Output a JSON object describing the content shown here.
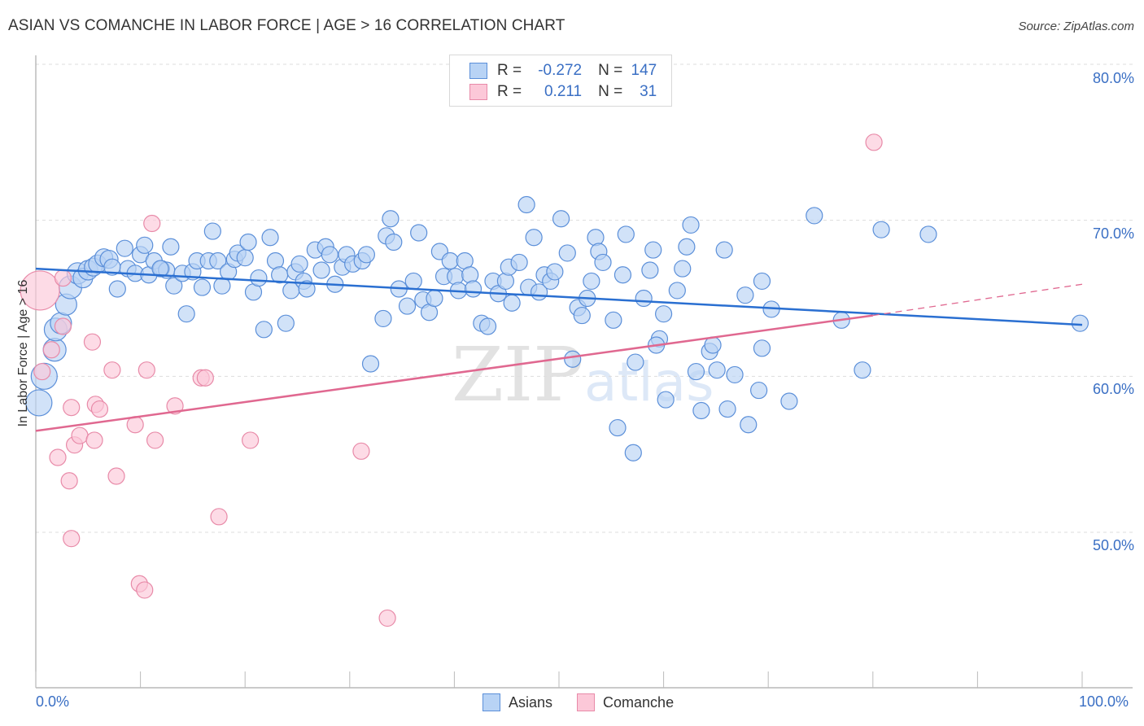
{
  "title": "ASIAN VS COMANCHE IN LABOR FORCE | AGE > 16 CORRELATION CHART",
  "source": "Source: ZipAtlas.com",
  "legend_box": {
    "rows": [
      {
        "r_label": "R =",
        "r_value": "-0.272",
        "n_label": "N =",
        "n_value": "147"
      },
      {
        "r_label": "R =",
        "r_value": "0.211",
        "n_label": "N =",
        "n_value": "31"
      }
    ]
  },
  "bottom_legend": {
    "items": [
      {
        "label": "Asians"
      },
      {
        "label": "Comanche"
      }
    ]
  },
  "colors": {
    "asians_fill": "#b8d3f5",
    "asians_stroke": "#5b8fd9",
    "asians_line": "#2a6fd1",
    "comanche_fill": "#fcc8d8",
    "comanche_stroke": "#e88aa8",
    "comanche_line": "#e06890",
    "tick_text": "#3a6fc4",
    "grid": "#dddddd"
  },
  "chart_data": {
    "type": "scatter",
    "title": "ASIAN VS COMANCHE IN LABOR FORCE | AGE > 16 CORRELATION CHART",
    "xlabel": "",
    "ylabel": "In Labor Force | Age > 16",
    "xlim": [
      0,
      100
    ],
    "ylim": [
      40,
      82
    ],
    "x_tick_labels": [
      {
        "value": 0,
        "label": "0.0%"
      },
      {
        "value": 100,
        "label": "100.0%"
      }
    ],
    "x_minor_ticks": [
      0,
      10,
      20,
      30,
      40,
      50,
      60,
      70,
      80,
      90,
      100
    ],
    "y_ticks": [
      {
        "value": 80,
        "label": "80.0%"
      },
      {
        "value": 70,
        "label": "70.0%"
      },
      {
        "value": 60,
        "label": "60.0%"
      },
      {
        "value": 50,
        "label": "50.0%"
      }
    ],
    "grid": true,
    "legend_placement": "top-center",
    "watermark": "ZIPatlas",
    "series": [
      {
        "name": "Asians",
        "r": -0.272,
        "n": 147,
        "trend": {
          "x": [
            0,
            100
          ],
          "y": [
            66.9,
            63.3
          ],
          "dashed_extension": false
        },
        "points": [
          [
            0.3,
            58.3,
            1.6
          ],
          [
            0.8,
            60.0,
            1.6
          ],
          [
            1.8,
            61.7,
            1.4
          ],
          [
            1.9,
            63.0,
            1.4
          ],
          [
            2.4,
            63.4,
            1.3
          ],
          [
            2.9,
            64.6,
            1.3
          ],
          [
            3.3,
            65.7,
            1.4
          ],
          [
            4.0,
            66.6,
            1.3
          ],
          [
            4.5,
            66.3,
            1.2
          ],
          [
            5.0,
            66.8,
            1.2
          ],
          [
            5.5,
            67.0,
            1.1
          ],
          [
            5.9,
            67.2,
            1.1
          ],
          [
            6.5,
            67.6,
            1.1
          ],
          [
            7.0,
            67.5,
            1.1
          ],
          [
            7.8,
            65.6,
            1.0
          ],
          [
            8.5,
            68.2,
            1.0
          ],
          [
            8.8,
            66.9,
            1.0
          ],
          [
            9.5,
            66.6,
            1.0
          ],
          [
            10.0,
            67.8,
            1.0
          ],
          [
            10.4,
            68.4,
            1.0
          ],
          [
            10.8,
            66.5,
            1.0
          ],
          [
            11.3,
            67.4,
            1.0
          ],
          [
            12.0,
            66.9,
            1.0
          ],
          [
            12.5,
            66.8,
            1.0
          ],
          [
            12.9,
            68.3,
            1.0
          ],
          [
            13.2,
            65.8,
            1.0
          ],
          [
            14.0,
            66.6,
            1.0
          ],
          [
            14.4,
            64.0,
            1.0
          ],
          [
            15.0,
            66.7,
            1.0
          ],
          [
            15.4,
            67.4,
            1.0
          ],
          [
            15.9,
            65.7,
            1.0
          ],
          [
            16.5,
            67.4,
            1.0
          ],
          [
            16.9,
            69.3,
            1.0
          ],
          [
            17.4,
            67.4,
            1.0
          ],
          [
            17.8,
            65.8,
            1.0
          ],
          [
            18.4,
            66.7,
            1.0
          ],
          [
            19.0,
            67.5,
            1.0
          ],
          [
            19.3,
            67.9,
            1.0
          ],
          [
            20.0,
            67.6,
            1.0
          ],
          [
            20.3,
            68.6,
            1.0
          ],
          [
            20.8,
            65.4,
            1.0
          ],
          [
            21.3,
            66.3,
            1.0
          ],
          [
            21.8,
            63.0,
            1.0
          ],
          [
            22.4,
            68.9,
            1.0
          ],
          [
            22.9,
            67.4,
            1.0
          ],
          [
            23.3,
            66.5,
            1.0
          ],
          [
            23.9,
            63.4,
            1.0
          ],
          [
            24.4,
            65.5,
            1.0
          ],
          [
            24.8,
            66.7,
            1.0
          ],
          [
            25.2,
            67.2,
            1.0
          ],
          [
            25.6,
            66.1,
            1.0
          ],
          [
            25.9,
            65.6,
            1.0
          ],
          [
            26.7,
            68.1,
            1.0
          ],
          [
            27.3,
            66.8,
            1.0
          ],
          [
            27.7,
            68.3,
            1.0
          ],
          [
            28.1,
            67.8,
            1.0
          ],
          [
            28.6,
            65.9,
            1.0
          ],
          [
            29.3,
            67.0,
            1.0
          ],
          [
            29.7,
            67.8,
            1.0
          ],
          [
            30.3,
            67.2,
            1.0
          ],
          [
            31.2,
            67.4,
            1.0
          ],
          [
            31.6,
            67.8,
            1.0
          ],
          [
            32.0,
            60.8,
            1.0
          ],
          [
            33.2,
            63.7,
            1.0
          ],
          [
            33.5,
            69.0,
            1.0
          ],
          [
            33.9,
            70.1,
            1.0
          ],
          [
            34.2,
            68.6,
            1.0
          ],
          [
            34.7,
            65.6,
            1.0
          ],
          [
            35.5,
            64.5,
            1.0
          ],
          [
            36.1,
            66.1,
            1.0
          ],
          [
            36.6,
            69.2,
            1.0
          ],
          [
            37.0,
            64.9,
            1.0
          ],
          [
            37.6,
            64.1,
            1.0
          ],
          [
            38.1,
            65.0,
            1.0
          ],
          [
            38.6,
            68.0,
            1.0
          ],
          [
            39.0,
            66.4,
            1.0
          ],
          [
            39.6,
            67.4,
            1.0
          ],
          [
            40.1,
            66.4,
            1.0
          ],
          [
            40.4,
            65.5,
            1.0
          ],
          [
            41.0,
            67.4,
            1.0
          ],
          [
            41.5,
            66.5,
            1.0
          ],
          [
            41.8,
            65.6,
            1.0
          ],
          [
            42.6,
            63.4,
            1.0
          ],
          [
            43.2,
            63.2,
            1.0
          ],
          [
            43.7,
            66.1,
            1.0
          ],
          [
            44.2,
            65.3,
            1.0
          ],
          [
            44.9,
            66.1,
            1.0
          ],
          [
            45.2,
            67.0,
            1.0
          ],
          [
            45.5,
            64.7,
            1.0
          ],
          [
            46.2,
            67.3,
            1.0
          ],
          [
            46.9,
            71.0,
            1.0
          ],
          [
            47.1,
            65.7,
            1.0
          ],
          [
            47.6,
            68.9,
            1.0
          ],
          [
            48.1,
            65.4,
            1.0
          ],
          [
            48.6,
            66.5,
            1.0
          ],
          [
            49.2,
            66.1,
            1.0
          ],
          [
            49.6,
            66.7,
            1.0
          ],
          [
            50.2,
            70.1,
            1.0
          ],
          [
            50.8,
            67.9,
            1.0
          ],
          [
            51.3,
            61.1,
            1.0
          ],
          [
            51.8,
            64.4,
            1.0
          ],
          [
            52.2,
            63.9,
            1.0
          ],
          [
            52.7,
            65.0,
            1.0
          ],
          [
            53.1,
            66.1,
            1.0
          ],
          [
            53.5,
            68.9,
            1.0
          ],
          [
            53.8,
            68.0,
            1.0
          ],
          [
            54.2,
            67.3,
            1.0
          ],
          [
            55.2,
            63.6,
            1.0
          ],
          [
            55.6,
            56.7,
            1.0
          ],
          [
            56.1,
            66.5,
            1.0
          ],
          [
            56.4,
            69.1,
            1.0
          ],
          [
            57.1,
            55.1,
            1.0
          ],
          [
            57.3,
            60.9,
            1.0
          ],
          [
            58.1,
            65.0,
            1.0
          ],
          [
            58.7,
            66.8,
            1.0
          ],
          [
            59.0,
            68.1,
            1.0
          ],
          [
            59.6,
            62.4,
            1.0
          ],
          [
            59.3,
            62.0,
            1.0
          ],
          [
            60.0,
            64.0,
            1.0
          ],
          [
            60.2,
            58.5,
            1.0
          ],
          [
            61.3,
            65.5,
            1.0
          ],
          [
            61.8,
            66.9,
            1.0
          ],
          [
            62.2,
            68.3,
            1.0
          ],
          [
            62.6,
            69.7,
            1.0
          ],
          [
            63.1,
            60.3,
            1.0
          ],
          [
            63.6,
            57.8,
            1.0
          ],
          [
            64.4,
            61.6,
            1.0
          ],
          [
            64.7,
            62.0,
            1.0
          ],
          [
            65.1,
            60.4,
            1.0
          ],
          [
            65.8,
            68.1,
            1.0
          ],
          [
            66.1,
            57.9,
            1.0
          ],
          [
            66.8,
            60.1,
            1.0
          ],
          [
            67.8,
            65.2,
            1.0
          ],
          [
            68.1,
            56.9,
            1.0
          ],
          [
            69.1,
            59.1,
            1.0
          ],
          [
            69.4,
            61.8,
            1.0
          ],
          [
            69.4,
            66.1,
            1.0
          ],
          [
            70.3,
            64.3,
            1.0
          ],
          [
            72.0,
            58.4,
            1.0
          ],
          [
            74.4,
            70.3,
            1.0
          ],
          [
            77.0,
            63.6,
            1.0
          ],
          [
            79.0,
            60.4,
            1.0
          ],
          [
            80.8,
            69.4,
            1.0
          ],
          [
            85.3,
            69.1,
            1.0
          ],
          [
            99.8,
            63.4,
            1.0
          ],
          [
            7.3,
            67.0,
            1.0
          ],
          [
            11.9,
            66.9,
            1.0
          ]
        ]
      },
      {
        "name": "Comanche",
        "r": 0.211,
        "n": 31,
        "trend": {
          "x": [
            0,
            80
          ],
          "y": [
            56.5,
            63.9
          ],
          "dashed_extension": {
            "x": [
              80,
              100
            ],
            "y": [
              63.9,
              65.9
            ]
          }
        },
        "points": [
          [
            0.4,
            65.5,
            2.4
          ],
          [
            0.6,
            60.3,
            1.0
          ],
          [
            1.5,
            61.7,
            1.0
          ],
          [
            2.1,
            54.8,
            1.0
          ],
          [
            2.6,
            63.2,
            1.0
          ],
          [
            2.6,
            66.3,
            1.0
          ],
          [
            3.2,
            53.3,
            1.0
          ],
          [
            3.4,
            49.6,
            1.0
          ],
          [
            3.4,
            58.0,
            1.0
          ],
          [
            3.7,
            55.6,
            1.0
          ],
          [
            4.2,
            56.2,
            1.0
          ],
          [
            5.4,
            62.2,
            1.0
          ],
          [
            5.6,
            55.9,
            1.0
          ],
          [
            5.7,
            58.2,
            1.0
          ],
          [
            6.1,
            57.9,
            1.0
          ],
          [
            7.3,
            60.4,
            1.0
          ],
          [
            7.7,
            53.6,
            1.0
          ],
          [
            9.5,
            56.9,
            1.0
          ],
          [
            9.9,
            46.7,
            1.0
          ],
          [
            10.4,
            46.3,
            1.0
          ],
          [
            10.6,
            60.4,
            1.0
          ],
          [
            11.1,
            69.8,
            1.0
          ],
          [
            11.4,
            55.9,
            1.0
          ],
          [
            13.3,
            58.1,
            1.0
          ],
          [
            15.8,
            59.9,
            1.0
          ],
          [
            17.5,
            51.0,
            1.0
          ],
          [
            20.5,
            55.9,
            1.0
          ],
          [
            31.1,
            55.2,
            1.0
          ],
          [
            33.6,
            44.5,
            1.0
          ],
          [
            80.1,
            75.0,
            1.0
          ],
          [
            16.2,
            59.9,
            1.0
          ]
        ]
      }
    ]
  }
}
